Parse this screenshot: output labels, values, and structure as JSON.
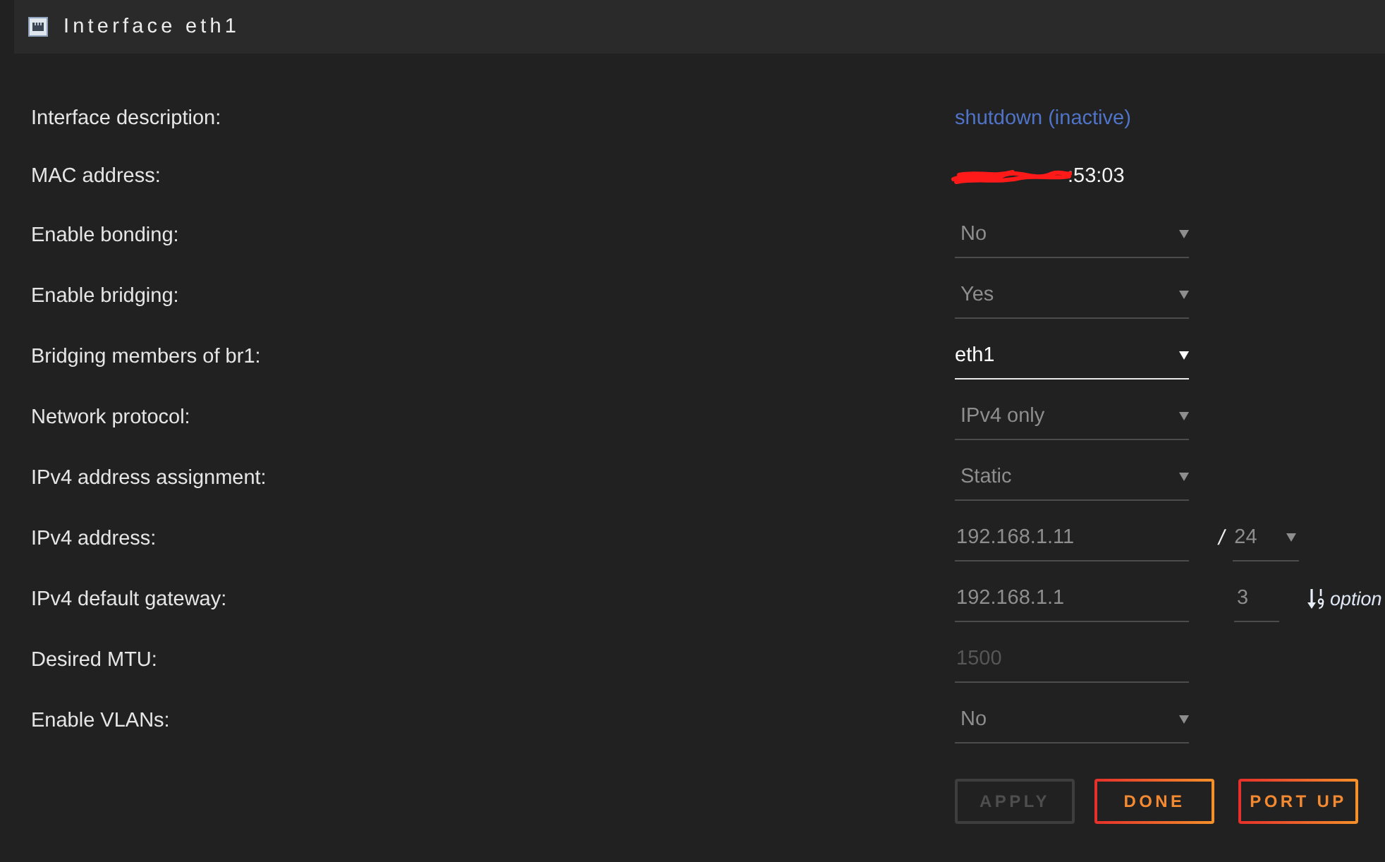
{
  "panel": {
    "title": "Interface eth1"
  },
  "fields": [
    {
      "kind": "link",
      "label": "Interface description:",
      "value": "shutdown (inactive)"
    },
    {
      "kind": "text",
      "label": "MAC address:",
      "value": ":53:03",
      "redacted": true
    },
    {
      "kind": "select",
      "label": "Enable bonding:",
      "value": "No",
      "focused": false
    },
    {
      "kind": "select",
      "label": "Enable bridging:",
      "value": "Yes",
      "focused": false
    },
    {
      "kind": "select",
      "label": "Bridging members of br1:",
      "value": "eth1",
      "focused": true
    },
    {
      "kind": "select",
      "label": "Network protocol:",
      "value": "IPv4 only",
      "focused": false
    },
    {
      "kind": "select",
      "label": "IPv4 address assignment:",
      "value": "Static",
      "focused": false
    },
    {
      "kind": "address",
      "label": "IPv4 address:",
      "value": "192.168.1.11",
      "separator": "/",
      "prefix": "24"
    },
    {
      "kind": "gateway",
      "label": "IPv4 default gateway:",
      "value": "192.168.1.1",
      "metric": "3",
      "link": "option"
    },
    {
      "kind": "input",
      "label": "Desired MTU:",
      "placeholder": "1500"
    },
    {
      "kind": "select",
      "label": "Enable VLANs:",
      "value": "No",
      "focused": false
    }
  ],
  "buttons": [
    {
      "label": "APPLY",
      "disabled": true
    },
    {
      "label": "DONE",
      "disabled": false
    },
    {
      "label": "PORT UP",
      "disabled": false
    }
  ]
}
